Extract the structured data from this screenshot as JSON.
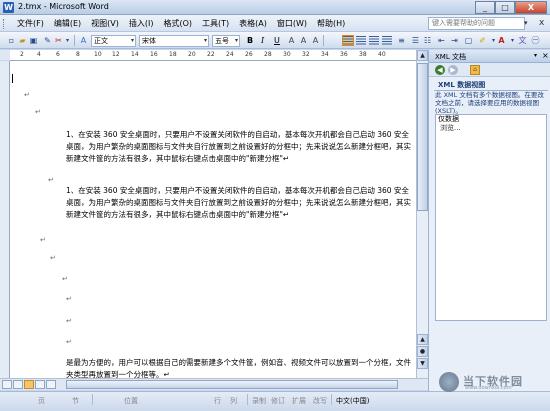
{
  "window": {
    "title": "2.tmx - Microsoft Word",
    "controls": [
      "_",
      "□",
      "X"
    ]
  },
  "menubar": {
    "items": [
      "文件(F)",
      "编辑(E)",
      "视图(V)",
      "插入(I)",
      "格式(O)",
      "工具(T)",
      "表格(A)",
      "窗口(W)",
      "帮助(H)"
    ],
    "help_placeholder": "键入需要帮助的问题",
    "close_doc": "x"
  },
  "toolbar": {
    "style_value": "正文",
    "font_value": "宋体",
    "size_value": "五号",
    "bold": "B",
    "italic": "I",
    "underline": "U"
  },
  "ruler": {
    "ticks": [
      "2",
      "4",
      "6",
      "8",
      "10",
      "12",
      "14",
      "16",
      "18",
      "20",
      "22",
      "24",
      "26",
      "28",
      "30",
      "32",
      "34",
      "36",
      "38",
      "40"
    ]
  },
  "document": {
    "paragraph_mark": "↵",
    "paragraphs": [
      "1、在安装 360 安全桌面时，只要用户不设置关闭软件的自启动，基本每次开机都会自己启动 360 安全桌面，为用户繁杂的桌面图标与文件夹自行放置到之前设置好的分框中；先来说说怎么新建分框吧，其实新建文件筐的方法有很多，其中鼠标右键点击桌面中的\"新建分框\"↵",
      "1、在安装 360 安全桌面时，只要用户不设置关闭软件的自启动，基本每次开机都会自己启动 360 安全桌面，为用户繁杂的桌面图标与文件夹自行放置到之前设置好的分框中；先来说说怎么新建分框吧，其实新建文件筐的方法有很多，其中鼠标右键点击桌面中的\"新建分框\"↵",
      "是最为方便的，用户可以根据自己的需要新建多个文件筐，例如音、视频文件可以放置到一个分框，文件夹类型再放置到一个分框等。↵"
    ]
  },
  "statusbar": {
    "page": "页",
    "section": "节",
    "position": "位置",
    "line": "行",
    "column": "列",
    "rec": "录制",
    "trk": "修订",
    "ext": "扩展",
    "ovr": "改写",
    "language": "中文(中国)"
  },
  "taskpane": {
    "title": "XML 文档",
    "section_title": "XML 数据视图",
    "description": "此 XML 文档有多个数据视图。在要改文档之前，请选择要应用的数据视图(XSLT)。",
    "list_items": [
      "仅数据",
      "浏览..."
    ]
  },
  "watermark": {
    "text": "当下软件园",
    "url": "www.downxia.com"
  },
  "colors": {
    "accent": "#2a5fb8",
    "chrome": "#c7d6ea",
    "active_highlight": "#f6c56b"
  }
}
